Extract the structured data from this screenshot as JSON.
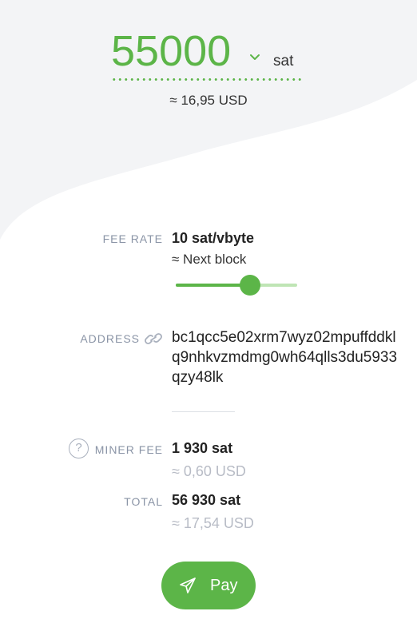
{
  "amount": {
    "value": "55000",
    "unit": "sat",
    "usd_approx": "≈ 16,95 USD",
    "chevron_icon": "chevron-down-icon"
  },
  "fee_rate": {
    "label": "FEE RATE",
    "value": "10 sat/vbyte",
    "estimate": "≈ Next block",
    "slider_level": 0.61
  },
  "address": {
    "label": "ADDRESS",
    "value": "bc1qcc5e02xrm7wyz02mpuffddklq9nhkvzmdmg0wh64qlls3du5933qzy48lk",
    "icon": "link-icon"
  },
  "miner_fee": {
    "label": "MINER FEE",
    "value": "1 930 sat",
    "usd": "≈ 0,60 USD",
    "help_icon": "question-icon",
    "help_glyph": "?"
  },
  "total": {
    "label": "TOTAL",
    "value": "56 930 sat",
    "usd": "≈ 17,54 USD"
  },
  "pay_button": {
    "label": "Pay",
    "icon": "paper-plane-icon"
  },
  "colors": {
    "accent": "#5cb548",
    "accent_light": "#bfe5b5",
    "background_shape": "#f3f4f6",
    "label": "#8a94a6",
    "muted": "#b8bcc6"
  }
}
